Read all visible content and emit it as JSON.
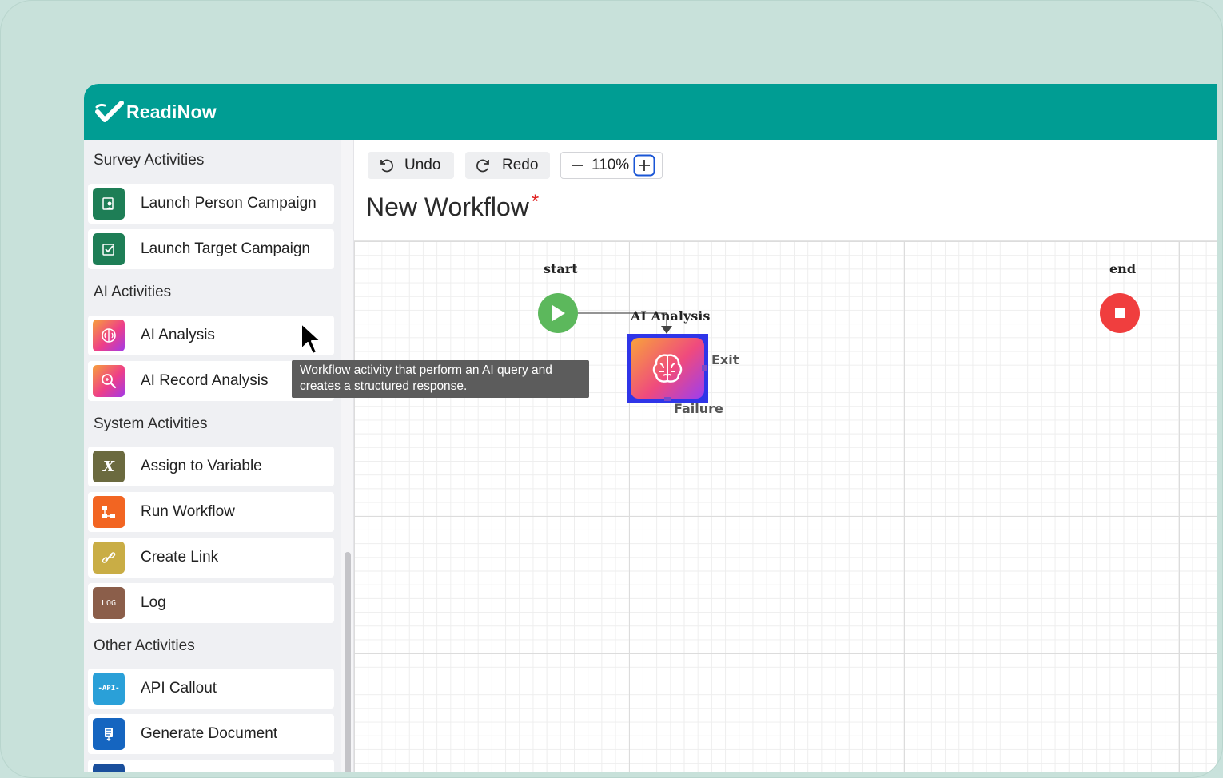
{
  "app": {
    "logo_text": "ReadiNow"
  },
  "sidebar": {
    "sections": [
      {
        "title": "Survey Activities",
        "items": [
          {
            "label": "Launch Person Campaign",
            "icon": "person-campaign-icon",
            "color": "#1e7e56"
          },
          {
            "label": "Launch Target Campaign",
            "icon": "target-campaign-icon",
            "color": "#1e7e56"
          }
        ]
      },
      {
        "title": "AI Activities",
        "items": [
          {
            "label": "AI Analysis",
            "icon": "brain-icon",
            "color": "#ef4e7b"
          },
          {
            "label": "AI Record Analysis",
            "icon": "record-search-icon",
            "color": "#ef4e7b"
          }
        ]
      },
      {
        "title": "System Activities",
        "items": [
          {
            "label": "Assign to Variable",
            "icon": "variable-x-icon",
            "color": "#6b6a3f",
            "glyph": "X"
          },
          {
            "label": "Run Workflow",
            "icon": "workflow-icon",
            "color": "#f26522"
          },
          {
            "label": "Create Link",
            "icon": "link-icon",
            "color": "#c9ad45"
          },
          {
            "label": "Log",
            "icon": "log-icon",
            "color": "#8b5e4a",
            "glyph": "LOG"
          }
        ]
      },
      {
        "title": "Other Activities",
        "items": [
          {
            "label": "API Callout",
            "icon": "api-icon",
            "color": "#2aa0d8",
            "glyph": "-API-"
          },
          {
            "label": "Generate Document",
            "icon": "document-icon",
            "color": "#1565c0"
          }
        ]
      }
    ]
  },
  "toolbar": {
    "undo_label": "Undo",
    "redo_label": "Redo",
    "zoom_level": "110%"
  },
  "workflow": {
    "title": "New Workflow",
    "unsaved_marker": "*",
    "start_label": "start",
    "end_label": "end",
    "node_label": "AI Analysis",
    "exit_port": "Exit",
    "failure_port": "Failure"
  },
  "tooltip": {
    "line1": "Workflow activity that perform an AI query and",
    "line2": "creates a structured response."
  },
  "colors": {
    "header": "#009d93",
    "start": "#5cb85c",
    "end": "#f03e3e",
    "selection": "#2f35e8"
  }
}
